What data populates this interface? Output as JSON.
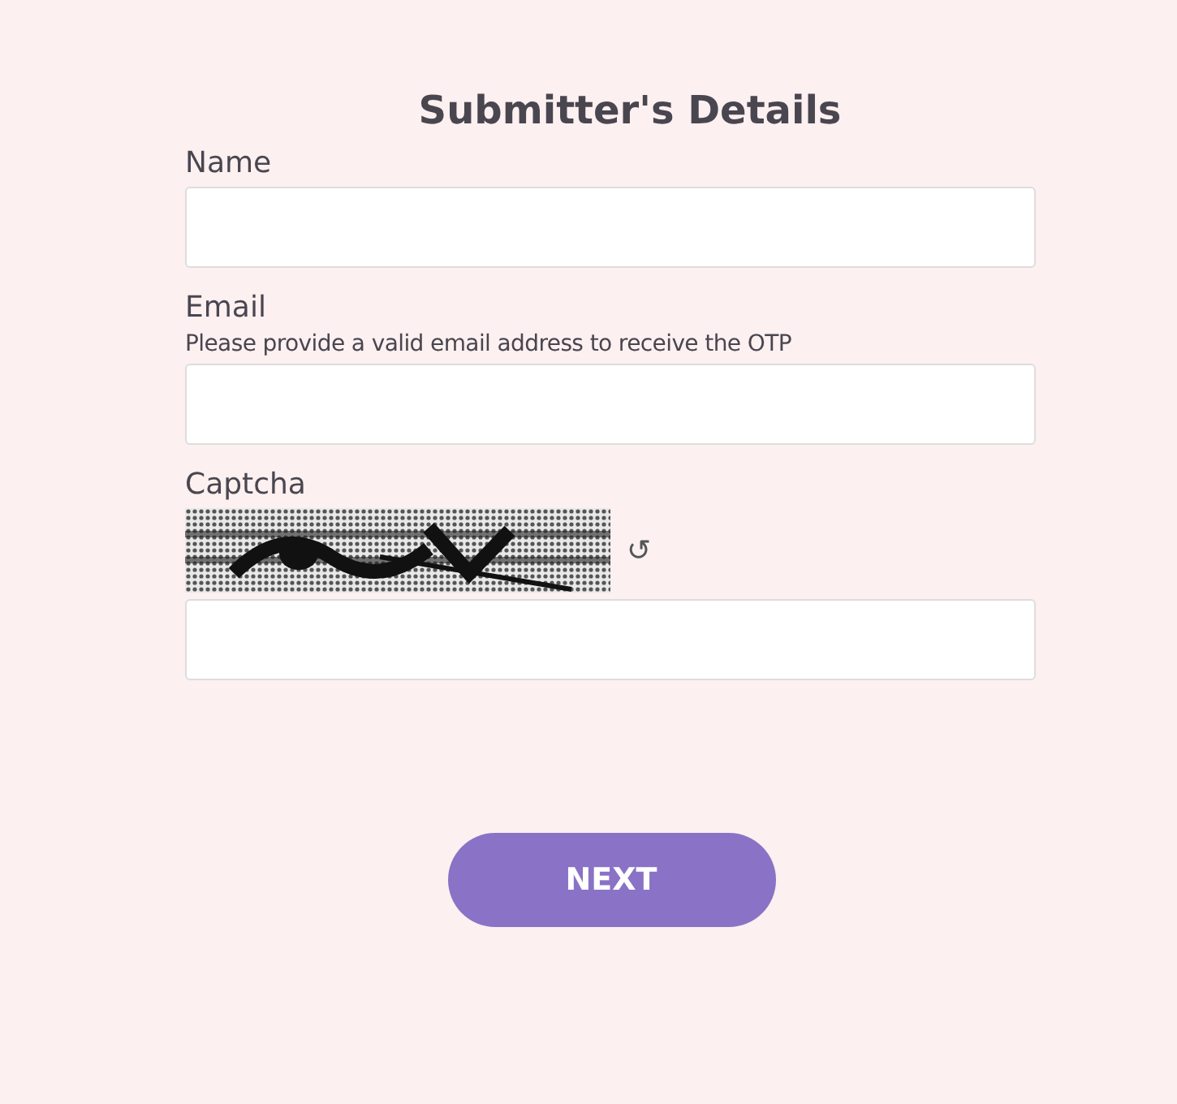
{
  "title": "Submitter's Details",
  "fields": [
    {
      "label": "Name"
    },
    {
      "label": "Email",
      "hint": "Please provide a valid email address to receive the OTP"
    },
    {
      "label": "Captcha",
      "captcha": {
        "kind": "picture",
        "refresh": "↺"
      }
    }
  ],
  "button": "NEXT"
}
